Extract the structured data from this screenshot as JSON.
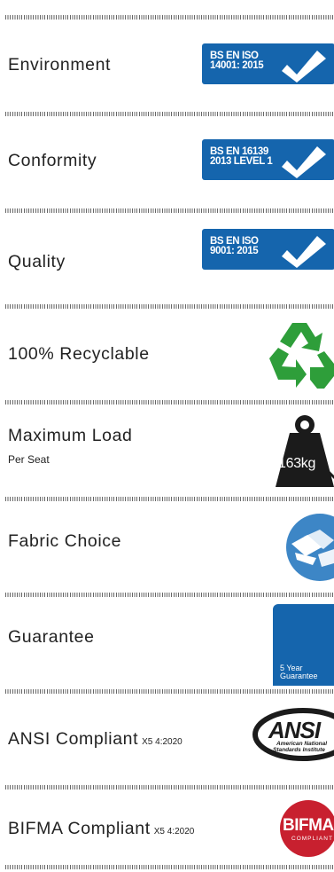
{
  "features": [
    {
      "label": "Environment",
      "badge_text": [
        "BS EN ISO",
        "14001: 2015"
      ],
      "icon": "check-icon"
    },
    {
      "label": "Conformity",
      "badge_text": [
        "BS EN 16139",
        "2013 LEVEL 1"
      ],
      "icon": "check-icon"
    },
    {
      "label": "Quality",
      "badge_text": [
        "BS EN ISO",
        "9001: 2015"
      ],
      "icon": "check-icon"
    },
    {
      "label": "100% Recyclable",
      "icon": "recycle-icon"
    },
    {
      "label": "Maximum Load",
      "sublabel": "Per Seat",
      "weight": "163kg",
      "icon": "weight-icon"
    },
    {
      "label": "Fabric Choice",
      "icon": "fabric-swatch-icon"
    },
    {
      "label": "Guarantee",
      "guarantee_text": [
        "5 Year",
        "Guarantee"
      ],
      "icon": "guarantee-icon"
    },
    {
      "label": "ANSI Compliant",
      "suffix": "X5 4:2020",
      "logo": {
        "main": "ANSI",
        "sub": [
          "American National",
          "Standards Institute"
        ]
      }
    },
    {
      "label": "BIFMA Compliant",
      "suffix": "X5 4:2020",
      "logo": {
        "main": "BIFMA",
        "sub": [
          "COMPLIANT"
        ]
      }
    }
  ],
  "colors": {
    "badge_blue": "#1565ad",
    "recycle_green": "#2e9e3a",
    "bifma_red": "#c8202f",
    "text": "#222222"
  }
}
